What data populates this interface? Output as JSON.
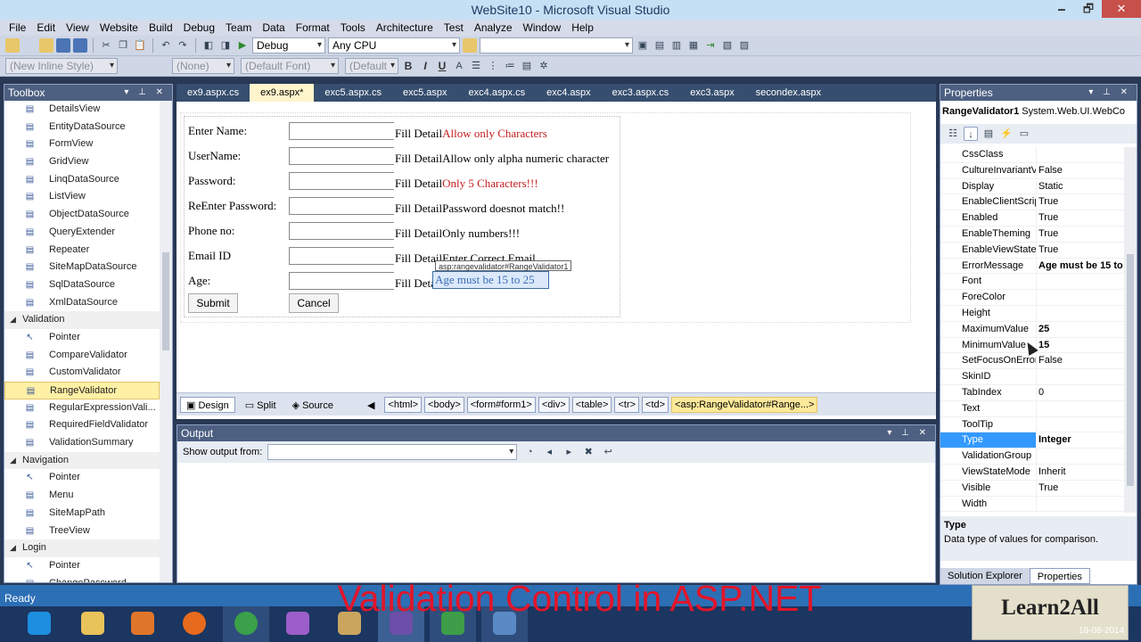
{
  "window": {
    "title": "WebSite10 - Microsoft Visual Studio",
    "min": "🗕",
    "max": "🗗",
    "close": "✕"
  },
  "menu": [
    "File",
    "Edit",
    "View",
    "Website",
    "Build",
    "Debug",
    "Team",
    "Data",
    "Format",
    "Tools",
    "Architecture",
    "Test",
    "Analyze",
    "Window",
    "Help"
  ],
  "toolbar1": {
    "config": "Debug",
    "platform": "Any CPU",
    "find": ""
  },
  "toolbar2": {
    "style": "(New Inline Style)",
    "block": "(None)",
    "font": "(Default Font)",
    "size": "(Default",
    "bold": "B",
    "italic": "I",
    "underline": "U"
  },
  "toolbox": {
    "title": "Toolbox",
    "items": [
      {
        "label": "DetailsView",
        "kind": "item"
      },
      {
        "label": "EntityDataSource",
        "kind": "item"
      },
      {
        "label": "FormView",
        "kind": "item"
      },
      {
        "label": "GridView",
        "kind": "item"
      },
      {
        "label": "LinqDataSource",
        "kind": "item"
      },
      {
        "label": "ListView",
        "kind": "item"
      },
      {
        "label": "ObjectDataSource",
        "kind": "item"
      },
      {
        "label": "QueryExtender",
        "kind": "item"
      },
      {
        "label": "Repeater",
        "kind": "item"
      },
      {
        "label": "SiteMapDataSource",
        "kind": "item"
      },
      {
        "label": "SqlDataSource",
        "kind": "item"
      },
      {
        "label": "XmlDataSource",
        "kind": "item"
      },
      {
        "label": "Validation",
        "kind": "cat"
      },
      {
        "label": "Pointer",
        "kind": "item"
      },
      {
        "label": "CompareValidator",
        "kind": "item"
      },
      {
        "label": "CustomValidator",
        "kind": "item"
      },
      {
        "label": "RangeValidator",
        "kind": "sel"
      },
      {
        "label": "RegularExpressionVali...",
        "kind": "item"
      },
      {
        "label": "RequiredFieldValidator",
        "kind": "item"
      },
      {
        "label": "ValidationSummary",
        "kind": "item"
      },
      {
        "label": "Navigation",
        "kind": "cat"
      },
      {
        "label": "Pointer",
        "kind": "item"
      },
      {
        "label": "Menu",
        "kind": "item"
      },
      {
        "label": "SiteMapPath",
        "kind": "item"
      },
      {
        "label": "TreeView",
        "kind": "item"
      },
      {
        "label": "Login",
        "kind": "cat"
      },
      {
        "label": "Pointer",
        "kind": "item"
      },
      {
        "label": "ChangePassword",
        "kind": "item"
      }
    ]
  },
  "tabs": [
    "ex9.aspx.cs",
    "ex9.aspx*",
    "exc5.aspx.cs",
    "exc5.aspx",
    "exc4.aspx.cs",
    "exc4.aspx",
    "exc3.aspx.cs",
    "exc3.aspx",
    "secondex.aspx"
  ],
  "form": {
    "rows": [
      {
        "label": "Enter Name:",
        "detail": "Fill Detail",
        "msg": "Allow only Characters",
        "red": true
      },
      {
        "label": "UserName:",
        "detail": "Fill Detail",
        "msg": "Allow only alpha numeric character",
        "red": false
      },
      {
        "label": "Password:",
        "detail": "Fill Detail",
        "msg": "Only 5 Characters!!!",
        "red": true
      },
      {
        "label": "ReEnter Password:",
        "detail": "Fill Detail",
        "msg": "Password doesnot match!!",
        "red": false
      },
      {
        "label": "Phone no:",
        "detail": "Fill Detail",
        "msg": "Only numbers!!!",
        "red": false
      },
      {
        "label": "Email ID",
        "detail": "Fill Detail",
        "msg": "Enter Correct Email",
        "red": false
      },
      {
        "label": "Age:",
        "detail": "Fill Detail",
        "msg": "",
        "red": false
      }
    ],
    "submit": "Submit",
    "cancel": "Cancel",
    "rv_tag": "asp:rangevalidator#RangeValidator1",
    "rv_text": "Age must be 15 to 25"
  },
  "viewbar": {
    "design": "Design",
    "split": "Split",
    "source": "Source",
    "crumbs": [
      "<html>",
      "<body>",
      "<form#form1>",
      "<div>",
      "<table>",
      "<tr>",
      "<td>",
      "<asp:RangeValidator#Range...>"
    ]
  },
  "output": {
    "title": "Output",
    "show_from": "Show output from:"
  },
  "properties": {
    "title": "Properties",
    "object": "RangeValidator1",
    "object_type": "System.Web.UI.WebCo",
    "rows": [
      {
        "name": "CssClass",
        "value": "",
        "bold": false
      },
      {
        "name": "CultureInvariantV",
        "value": "False",
        "bold": false
      },
      {
        "name": "Display",
        "value": "Static",
        "bold": false
      },
      {
        "name": "EnableClientScrip",
        "value": "True",
        "bold": false
      },
      {
        "name": "Enabled",
        "value": "True",
        "bold": false
      },
      {
        "name": "EnableTheming",
        "value": "True",
        "bold": false
      },
      {
        "name": "EnableViewState",
        "value": "True",
        "bold": false
      },
      {
        "name": "ErrorMessage",
        "value": "Age must be 15 to",
        "bold": true
      },
      {
        "name": "Font",
        "value": "",
        "bold": false
      },
      {
        "name": "ForeColor",
        "value": "",
        "bold": false
      },
      {
        "name": "Height",
        "value": "",
        "bold": false
      },
      {
        "name": "MaximumValue",
        "value": "25",
        "bold": true
      },
      {
        "name": "MinimumValue",
        "value": "15",
        "bold": true
      },
      {
        "name": "SetFocusOnError",
        "value": "False",
        "bold": false
      },
      {
        "name": "SkinID",
        "value": "",
        "bold": false
      },
      {
        "name": "TabIndex",
        "value": "0",
        "bold": false
      },
      {
        "name": "Text",
        "value": "",
        "bold": false
      },
      {
        "name": "ToolTip",
        "value": "",
        "bold": false
      },
      {
        "name": "Type",
        "value": "Integer",
        "bold": true
      },
      {
        "name": "ValidationGroup",
        "value": "",
        "bold": false
      },
      {
        "name": "ViewStateMode",
        "value": "Inherit",
        "bold": false
      },
      {
        "name": "Visible",
        "value": "True",
        "bold": false
      },
      {
        "name": "Width",
        "value": "",
        "bold": false
      }
    ],
    "desc_title": "Type",
    "desc_text": "Data type of values for comparison.",
    "tab_solution": "Solution Explorer",
    "tab_properties": "Properties"
  },
  "status": "Ready",
  "overlay": "Validation Control in ASP.NET",
  "logo": "Learn2All",
  "clock": "18-08-2014"
}
